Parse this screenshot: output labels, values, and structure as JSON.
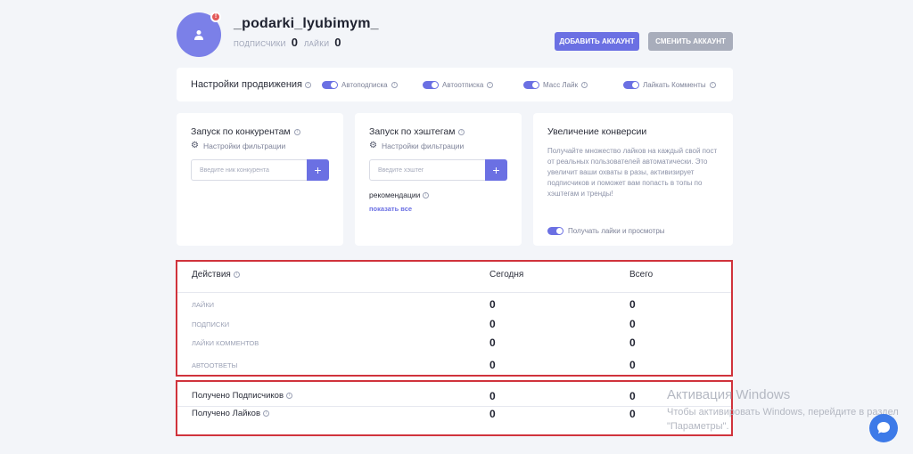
{
  "header": {
    "username": "_podarki_lyubimym_",
    "followers_label": "ПОДПИСЧИКИ",
    "followers_value": "0",
    "likes_label": "ЛАЙКИ",
    "likes_value": "0",
    "add_account": "ДОБАВИТЬ АККАУНТ",
    "change_account": "СМЕНИТЬ АККАУНТ",
    "badge": "!"
  },
  "promo": {
    "title": "Настройки продвижения",
    "toggles": [
      {
        "label": "Автоподписка",
        "on": true
      },
      {
        "label": "Автоотписка",
        "on": true
      },
      {
        "label": "Масс Лайк",
        "on": true
      },
      {
        "label": "Лайкать Комменты",
        "on": true
      }
    ]
  },
  "competitors": {
    "title": "Запуск по конкурентам",
    "filter": "Настройки фильтрации",
    "placeholder": "Введите ник конкурента",
    "plus": "+"
  },
  "hashtags": {
    "title": "Запуск по хэштегам",
    "filter": "Настройки фильтрации",
    "placeholder": "Введите хэштег",
    "plus": "+",
    "recommendations": "рекомендации",
    "show_all": "показать все"
  },
  "conversion": {
    "title": "Увеличение конверсии",
    "text": "Получайте множество лайков на каждый свой пост от реальных пользователей автоматически. Это увеличит ваши охваты в разы, активизирует подписчиков и поможет вам попасть в топы по хэштегам и тренды!",
    "toggle_label": "Получать лайки и просмотры"
  },
  "actions": {
    "headers": [
      "Действия",
      "Сегодня",
      "Всего"
    ],
    "rows": [
      {
        "label": "ЛАЙКИ",
        "today": "0",
        "total": "0"
      },
      {
        "label": "ПОДПИСКИ",
        "today": "0",
        "total": "0"
      },
      {
        "label": "ЛАЙКИ КОММЕНТОВ",
        "today": "0",
        "total": "0"
      },
      {
        "label": "АВТООТВЕТЫ",
        "today": "0",
        "total": "0"
      }
    ],
    "received": [
      {
        "label": "Получено Подписчиков",
        "today": "0",
        "total": "0"
      },
      {
        "label": "Получено Лайков",
        "today": "0",
        "total": "0"
      }
    ]
  },
  "watermark": {
    "title": "Активация Windows",
    "text": "Чтобы активировать Windows, перейдите в раздел \"Параметры\"."
  },
  "colors": {
    "accent": "#6b70e3",
    "highlight": "#d0333c",
    "background": "#f3f5f9"
  }
}
